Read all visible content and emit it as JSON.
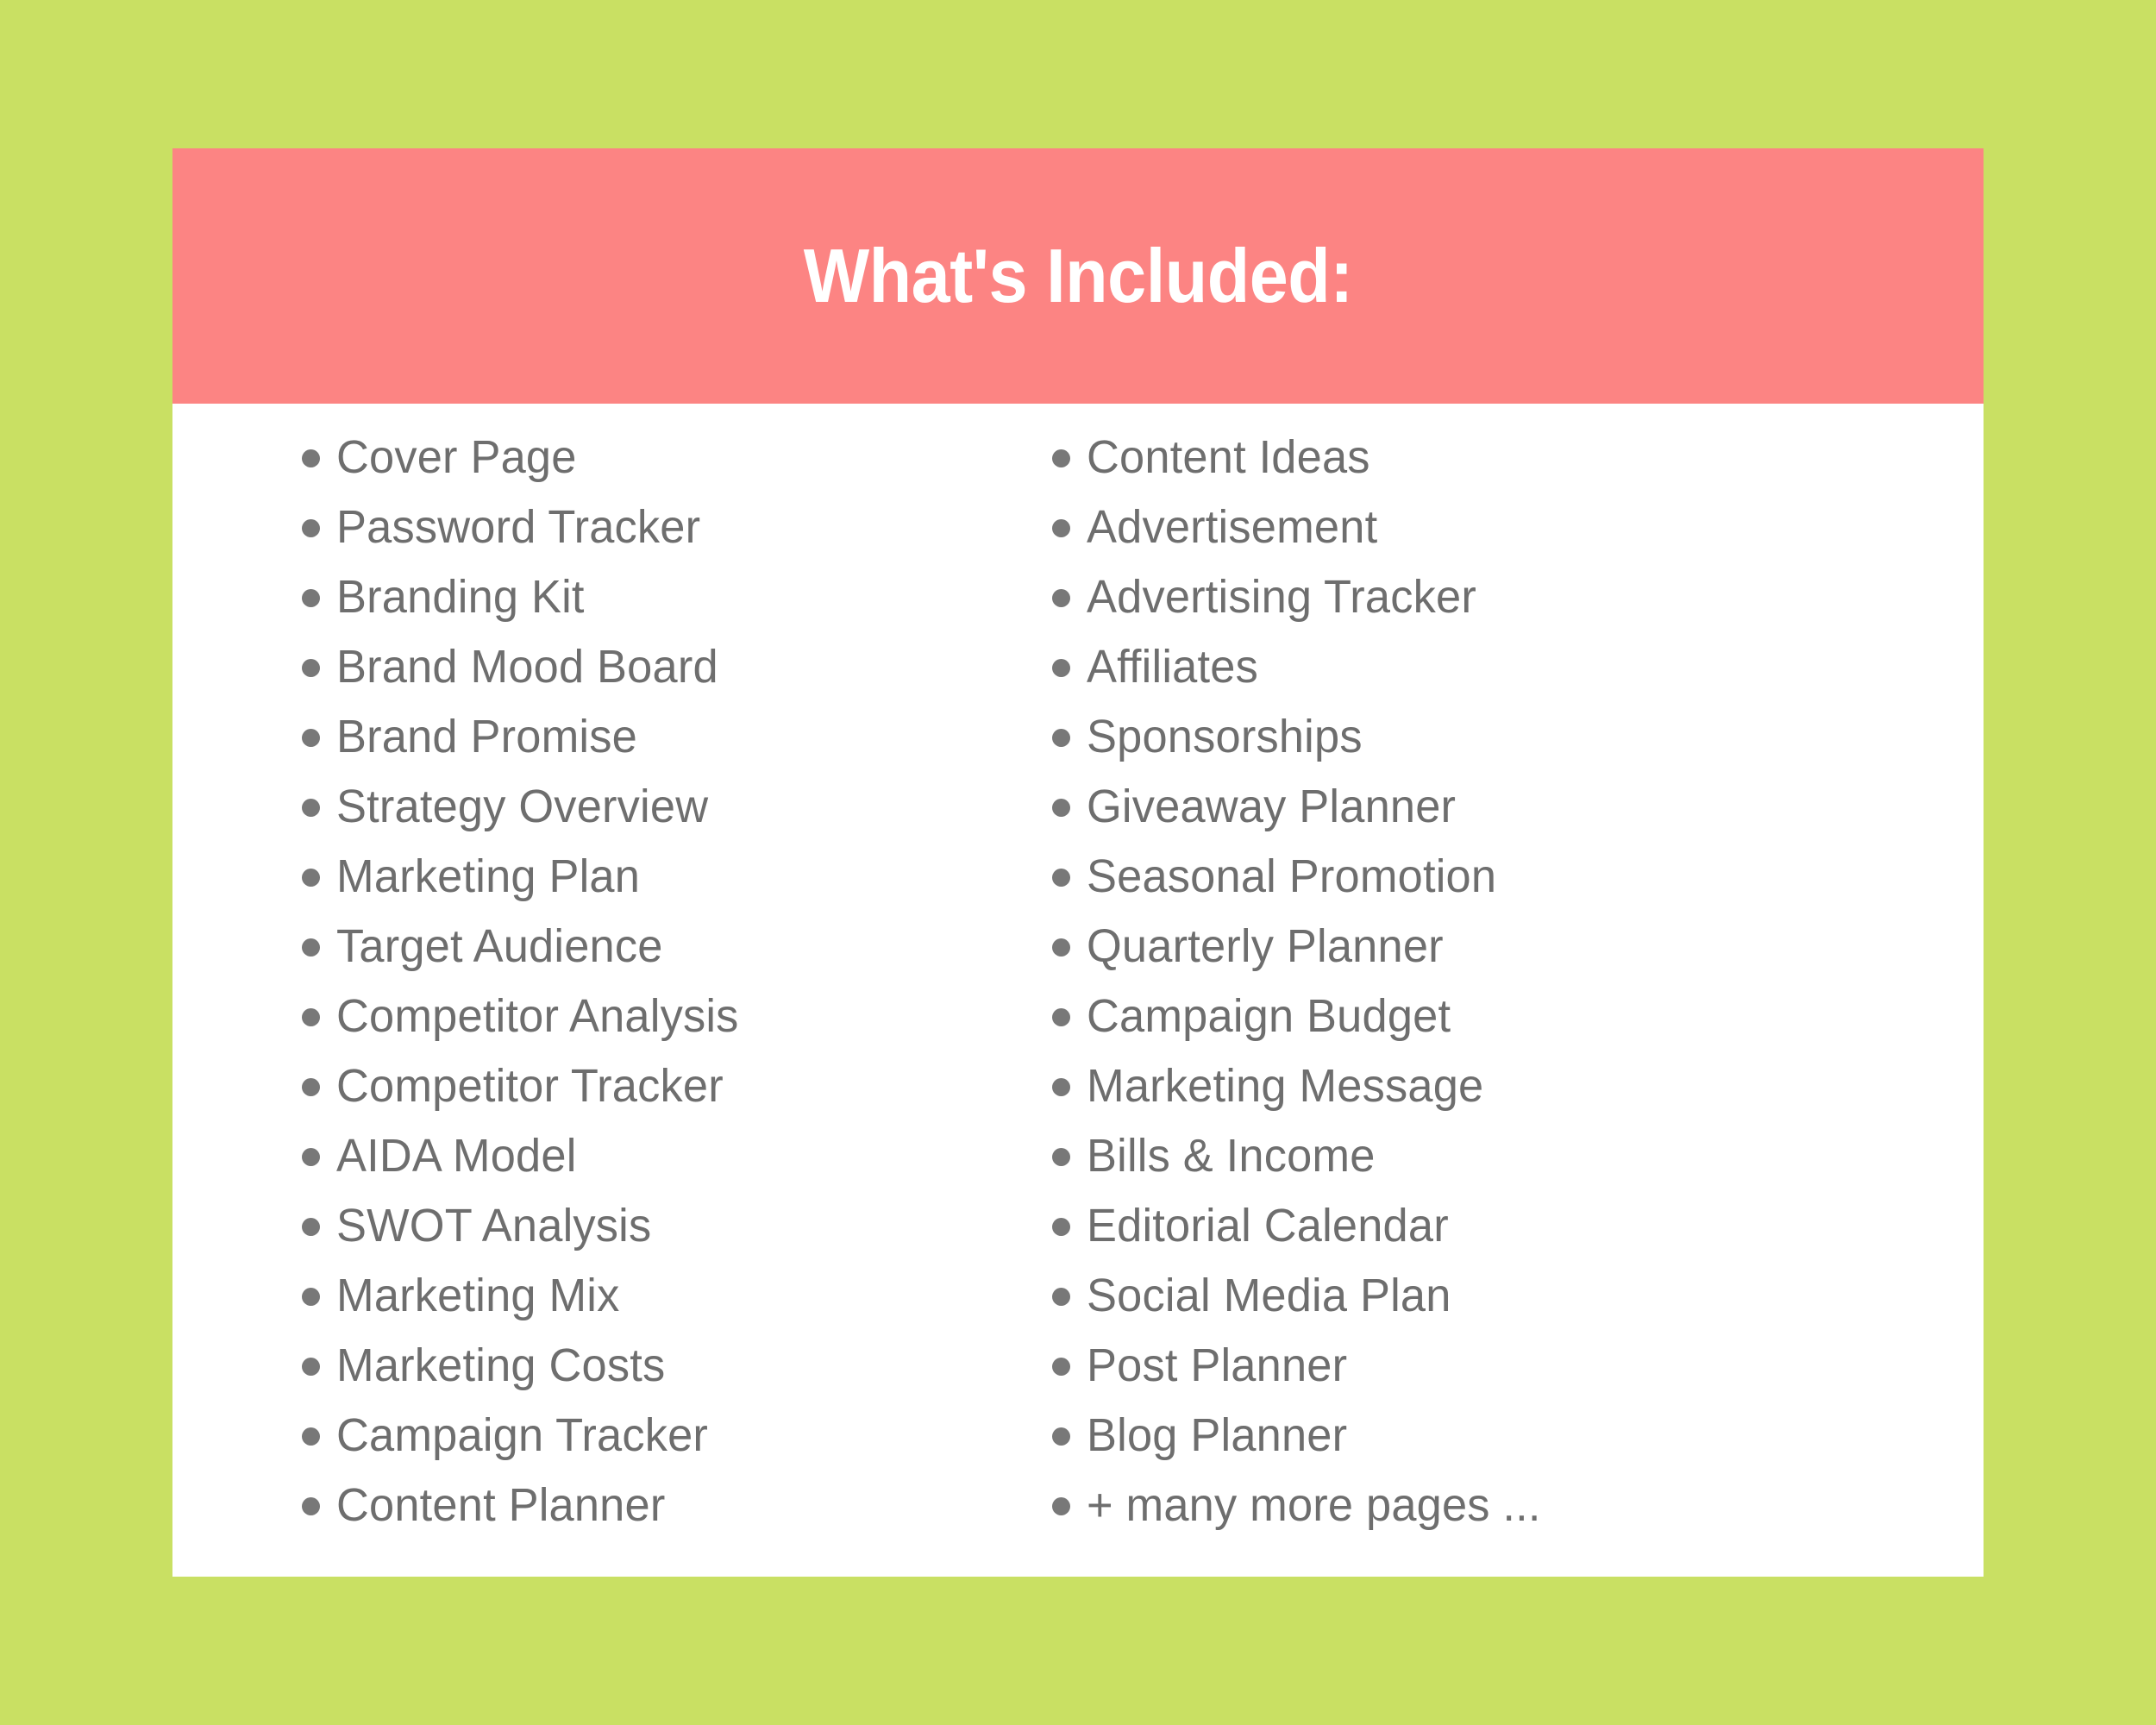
{
  "colors": {
    "background_green": "#C9E063",
    "header_coral": "#FC8483",
    "card_white": "#FFFFFF",
    "text_gray": "#6E6E6E",
    "bullet_gray": "#787878",
    "title_white": "#FFFFFF"
  },
  "header": {
    "title": "What's Included:"
  },
  "content": {
    "columns": [
      {
        "name": "left-column",
        "items": [
          {
            "label": "Cover Page"
          },
          {
            "label": "Password Tracker"
          },
          {
            "label": "Branding Kit"
          },
          {
            "label": "Brand Mood Board"
          },
          {
            "label": "Brand Promise"
          },
          {
            "label": "Strategy Overview"
          },
          {
            "label": "Marketing Plan"
          },
          {
            "label": "Target Audience"
          },
          {
            "label": "Competitor Analysis"
          },
          {
            "label": "Competitor Tracker"
          },
          {
            "label": "AIDA Model"
          },
          {
            "label": "SWOT Analysis"
          },
          {
            "label": "Marketing Mix"
          },
          {
            "label": "Marketing Costs"
          },
          {
            "label": "Campaign Tracker"
          },
          {
            "label": "Content Planner"
          }
        ]
      },
      {
        "name": "right-column",
        "items": [
          {
            "label": "Content Ideas"
          },
          {
            "label": "Advertisement"
          },
          {
            "label": "Advertising Tracker"
          },
          {
            "label": "Affiliates"
          },
          {
            "label": "Sponsorships"
          },
          {
            "label": "Giveaway Planner"
          },
          {
            "label": "Seasonal Promotion"
          },
          {
            "label": "Quarterly Planner"
          },
          {
            "label": "Campaign Budget"
          },
          {
            "label": "Marketing Message"
          },
          {
            "label": "Bills & Income"
          },
          {
            "label": "Editorial Calendar"
          },
          {
            "label": "Social Media Plan"
          },
          {
            "label": "Post Planner"
          },
          {
            "label": "Blog Planner"
          },
          {
            "label": "+ many more pages ..."
          }
        ]
      }
    ]
  }
}
